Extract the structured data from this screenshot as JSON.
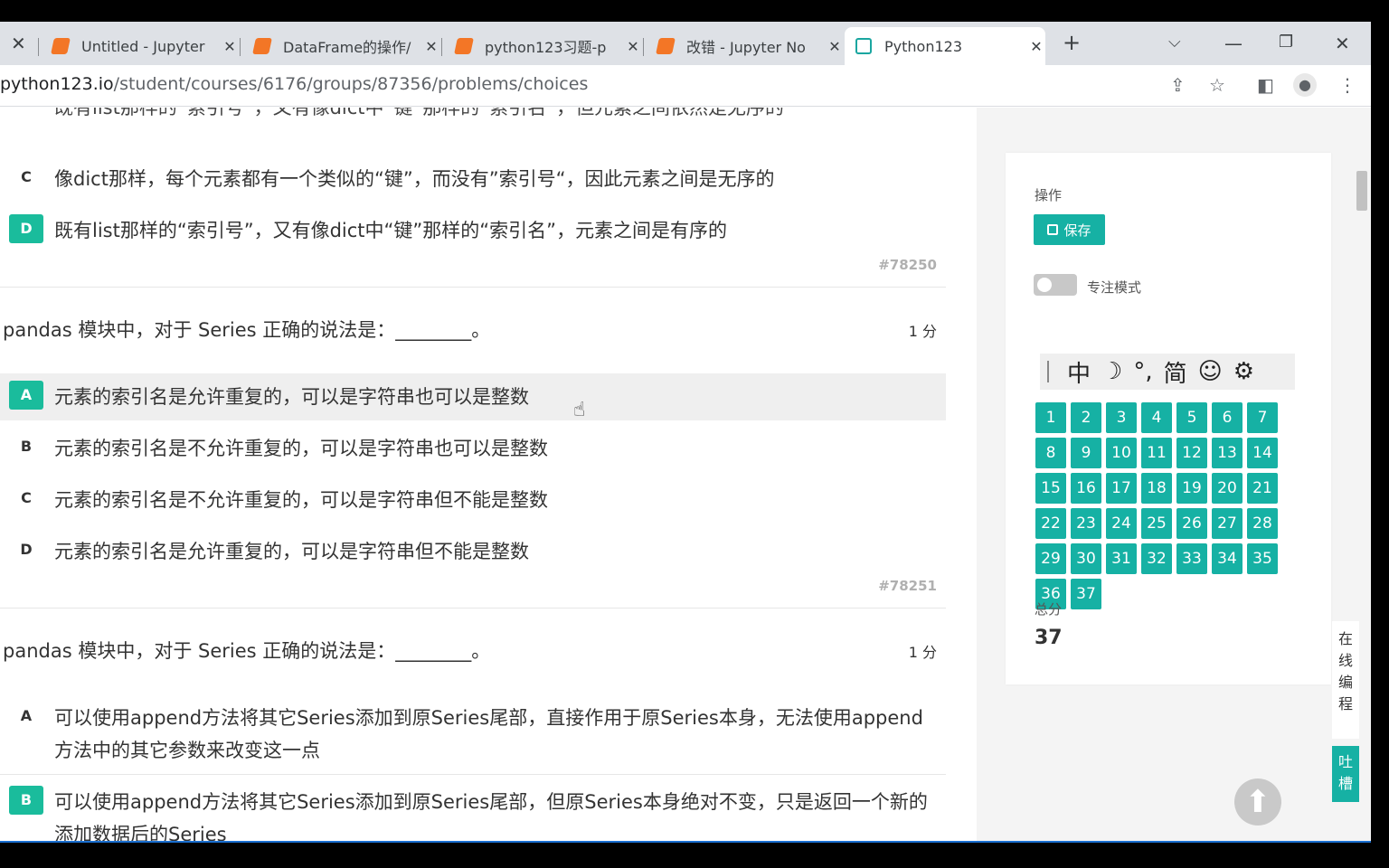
{
  "browser": {
    "tabs": [
      {
        "title": "Untitled - Jupyter",
        "active": false
      },
      {
        "title": "DataFrame的操作/",
        "active": false
      },
      {
        "title": "python123习题-p",
        "active": false
      },
      {
        "title": "改错 - Jupyter No",
        "active": false
      },
      {
        "title": "Python123",
        "active": true
      }
    ],
    "url_host": "python123.io",
    "url_path": "/student/courses/6176/groups/87356/problems/choices",
    "new_tab_symbol": "+",
    "close_symbol": "✕"
  },
  "questions": {
    "prev": {
      "partial_text": "既有list那样的“索引号”，又有像dict中“键”那样的“索引名”，但元素之间依然是无序的",
      "options": [
        {
          "letter": "C",
          "text": "像dict那样，每个元素都有一个类似的“键”，而没有”索引号“，因此元素之间是无序的"
        },
        {
          "letter": "D",
          "text": "既有list那样的“索引号”，又有像dict中“键”那样的“索引名”，元素之间是有序的"
        }
      ],
      "id": "#78250"
    },
    "q1": {
      "text": "pandas 模块中，对于 Series 正确的说法是：________。",
      "score": "1 分",
      "options": [
        {
          "letter": "A",
          "text": "元素的索引名是允许重复的，可以是字符串也可以是整数"
        },
        {
          "letter": "B",
          "text": "元素的索引名是不允许重复的，可以是字符串也可以是整数"
        },
        {
          "letter": "C",
          "text": "元素的索引名是不允许重复的，可以是字符串但不能是整数"
        },
        {
          "letter": "D",
          "text": "元素的索引名是允许重复的，可以是字符串但不能是整数"
        }
      ],
      "id": "#78251"
    },
    "q2": {
      "text": "pandas 模块中，对于 Series 正确的说法是：________。",
      "score": "1 分",
      "options": [
        {
          "letter": "A",
          "text": "可以使用append方法将其它Series添加到原Series尾部，直接作用于原Series本身，无法使用append方法中的其它参数来改变这一点"
        },
        {
          "letter": "B",
          "text": "可以使用append方法将其它Series添加到原Series尾部，但原Series本身绝对不变，只是返回一个新的添加数据后的Series"
        }
      ]
    }
  },
  "panel": {
    "ops_label": "操作",
    "save_label": "保存",
    "focus_label": "专注模式",
    "ime": [
      "中",
      "☽",
      "°,",
      "简",
      "☺",
      "⚙"
    ],
    "numbers": [
      "1",
      "2",
      "3",
      "4",
      "5",
      "6",
      "7",
      "8",
      "9",
      "10",
      "11",
      "12",
      "13",
      "14",
      "15",
      "16",
      "17",
      "18",
      "19",
      "20",
      "21",
      "22",
      "23",
      "24",
      "25",
      "26",
      "27",
      "28",
      "29",
      "30",
      "31",
      "32",
      "33",
      "34",
      "35",
      "36",
      "37"
    ],
    "total_label": "总分",
    "total_value": "37",
    "side_online": [
      "在",
      "线",
      "编",
      "程"
    ],
    "side_feedback": [
      "吐",
      "槽"
    ]
  },
  "colors": {
    "accent": "#16b1a4",
    "selected_letter": "#1abc9c"
  }
}
